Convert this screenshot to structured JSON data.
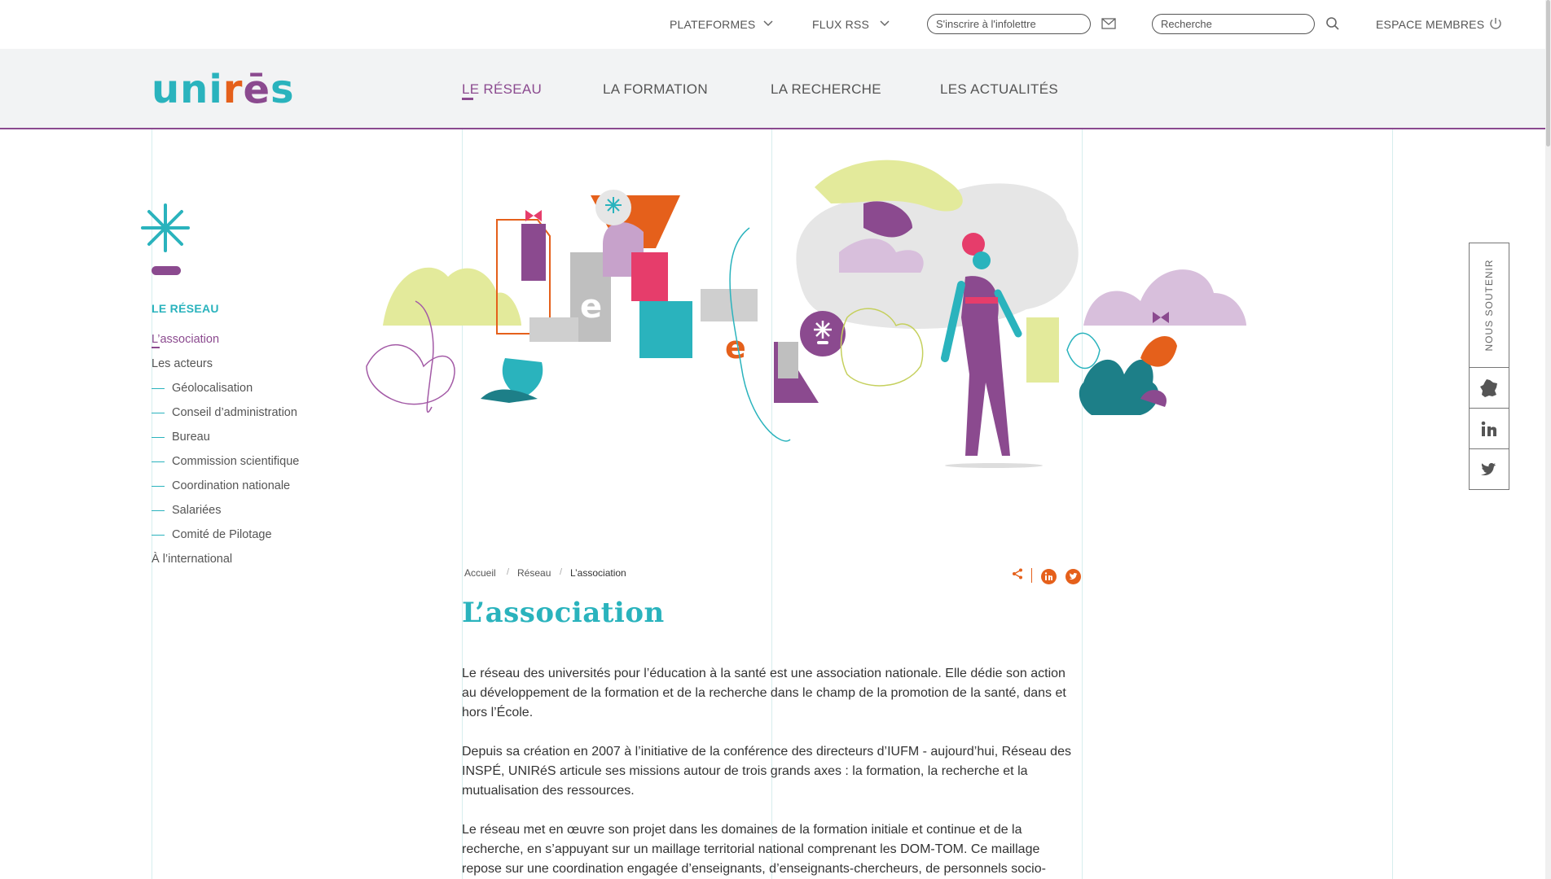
{
  "topbar": {
    "plateformes": "PLATEFORMES",
    "flux_rss": "FLUX RSS",
    "newsletter_placeholder": "S'inscrire à l'infolettre",
    "search_placeholder": "Recherche",
    "espace_membres": "ESPACE MEMBRES"
  },
  "logo": {
    "u": "un",
    "i": "i",
    "r": "r",
    "e": "ē",
    "s": "s"
  },
  "nav": {
    "reseau": "LE RÉSEAU",
    "formation": "LA FORMATION",
    "recherche": "LA RECHERCHE",
    "actualites": "LES ACTUALITÉS"
  },
  "sidebar": {
    "title": "LE RÉSEAU",
    "association": "L’association",
    "acteurs": "Les acteurs",
    "sub": [
      "Géolocalisation",
      "Conseil d’administration",
      "Bureau",
      "Commission scientifique",
      "Coordination nationale",
      "Salariées",
      "Comité de Pilotage"
    ],
    "international": "À l’international"
  },
  "breadcrumb": {
    "home": "Accueil",
    "reseau": "Réseau",
    "current": "L’association",
    "sep": "/"
  },
  "main": {
    "title": "L’association",
    "p1": "Le réseau des universités pour l’éducation à la santé est une association nationale. Elle dédie son action au développement de la formation et de la recherche dans le champ de la promotion de la santé, dans et hors l’École.",
    "p2": "Depuis sa création en 2007 à l’initiative de la conférence des directeurs d’IUFM - aujourd’hui, Réseau des INSPÉ, UNIRéS articule ses missions autour de trois grands axes : la formation, la recherche et la mutualisation des ressources.",
    "p3": "Le réseau met en œuvre son projet dans les domaines de la formation initiale et continue et de la recherche, en s’appuyant sur un maillage territorial national comprenant les DOM-TOM. Ce maillage repose sur une coordination engagée d’enseignants, d’enseignants-chercheurs, de personnels socio-"
  },
  "rail": {
    "soutenir": "NOUS SOUTENIR"
  },
  "colors": {
    "teal": "#2ab3bd",
    "purple": "#8b4a8f",
    "orange": "#e5601b"
  }
}
